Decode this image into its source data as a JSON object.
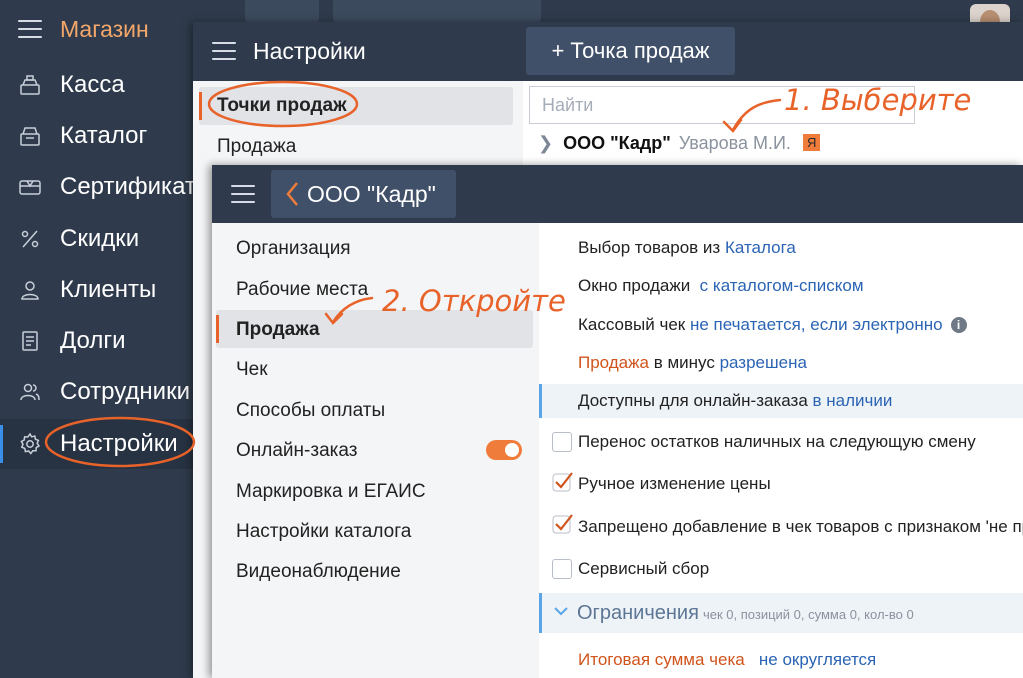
{
  "sidebar": {
    "title": "Магазин",
    "items": [
      {
        "label": "Касса",
        "icon": "cash-register-icon"
      },
      {
        "label": "Каталог",
        "icon": "catalog-icon"
      },
      {
        "label": "Сертификаты",
        "icon": "certificate-icon"
      },
      {
        "label": "Скидки",
        "icon": "percent-icon"
      },
      {
        "label": "Клиенты",
        "icon": "clients-icon"
      },
      {
        "label": "Долги",
        "icon": "debts-icon"
      },
      {
        "label": "Сотрудники",
        "icon": "employees-icon"
      },
      {
        "label": "Настройки",
        "icon": "gear-icon",
        "active": true
      }
    ]
  },
  "settings_panel": {
    "title": "Настройки",
    "add_button": "+ Точка продаж",
    "menu": [
      {
        "label": "Точки продаж",
        "active": true
      },
      {
        "label": "Продажа"
      }
    ],
    "search_placeholder": "Найти",
    "org_row": {
      "name": "ООО \"Кадр\"",
      "user": "Уварова М.И.",
      "badge": "Я"
    }
  },
  "org_panel": {
    "back_label": "ООО \"Кадр\"",
    "menu": [
      {
        "label": "Организация"
      },
      {
        "label": "Рабочие места"
      },
      {
        "label": "Продажа",
        "active": true
      },
      {
        "label": "Чек"
      },
      {
        "label": "Способы оплаты"
      },
      {
        "label": "Онлайн-заказ",
        "toggle": true
      },
      {
        "label": "Маркировка и ЕГАИС"
      },
      {
        "label": "Настройки каталога"
      },
      {
        "label": "Видеонаблюдение"
      }
    ],
    "settings": {
      "goods_choice_label": "Выбор товаров из",
      "goods_choice_value": "Каталога",
      "sale_window_label": "Окно продажи",
      "sale_window_value": "с каталогом-списком",
      "receipt_label": "Кассовый чек",
      "receipt_value": "не печатается, если электронно",
      "negative_sale_a": "Продажа",
      "negative_sale_b": "в минус",
      "negative_sale_value": "разрешена",
      "online_label": "Доступны для онлайн-заказа",
      "online_value": "в наличии",
      "cash_transfer": "Перенос остатков наличных на следующую смену",
      "manual_price": "Ручное изменение цены",
      "forbidden_add": "Запрещено добавление в чек товаров с признаком 'не пр",
      "service_fee": "Сервисный сбор",
      "limits_title": "Ограничения",
      "limits_summary": "чек 0, позиций 0, сумма 0, кол-во 0",
      "total_label": "Итоговая сумма чека",
      "total_value": "не округляется"
    }
  },
  "annotations": {
    "step1": "1. Выберите",
    "step2": "2. Откройте"
  },
  "colors": {
    "accent": "#e8632a",
    "sidebar_bg": "#2f3b4c",
    "link": "#2b64b4"
  }
}
